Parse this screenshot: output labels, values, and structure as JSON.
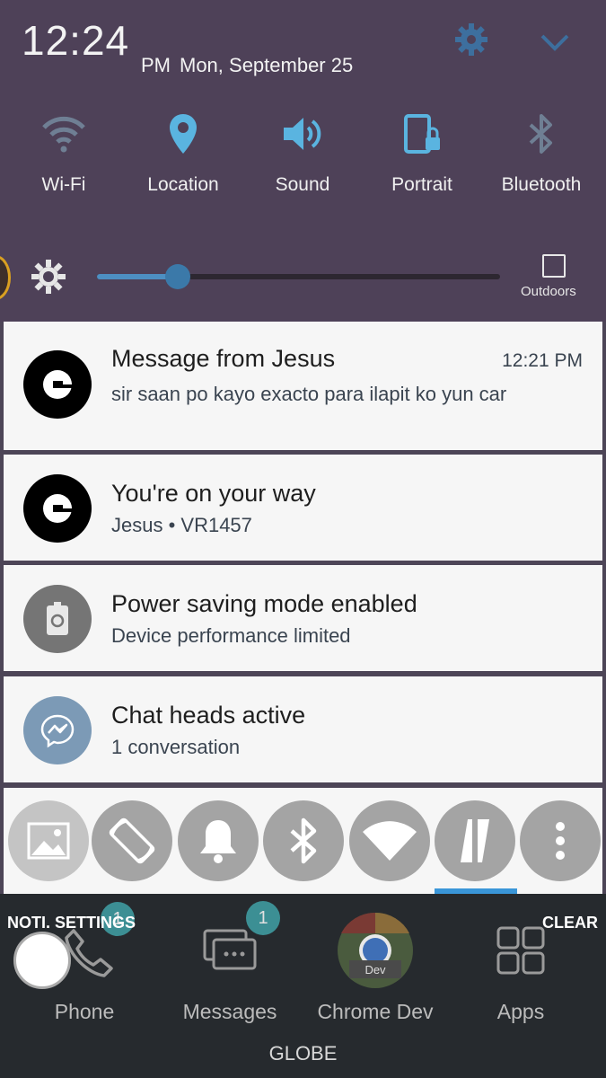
{
  "status": {
    "time": "12:24",
    "ampm": "PM",
    "date": "Mon, September 25"
  },
  "quick_settings": [
    {
      "label": "Wi-Fi",
      "icon": "wifi-icon"
    },
    {
      "label": "Location",
      "icon": "location-pin-icon"
    },
    {
      "label": "Sound",
      "icon": "sound-icon"
    },
    {
      "label": "Portrait",
      "icon": "portrait-lock-icon"
    },
    {
      "label": "Bluetooth",
      "icon": "bluetooth-icon"
    }
  ],
  "brightness": {
    "level": 0.2,
    "outdoors_label": "Outdoors"
  },
  "notifications": [
    {
      "app_icon": "uber-icon",
      "title": "Message from Jesus",
      "time": "12:21 PM",
      "text": "sir saan po kayo exacto para ilapit ko yun car"
    },
    {
      "app_icon": "uber-icon",
      "title": "You're on your way",
      "text": "Jesus • VR1457"
    },
    {
      "app_icon": "battery-recycle-icon",
      "title": "Power saving mode enabled",
      "text": "Device performance limited"
    },
    {
      "app_icon": "messenger-icon",
      "title": "Chat heads active",
      "text": "1 conversation"
    }
  ],
  "toggles": [
    {
      "icon": "image-icon"
    },
    {
      "icon": "auto-rotate-icon"
    },
    {
      "icon": "bell-icon"
    },
    {
      "icon": "bluetooth-icon"
    },
    {
      "icon": "wifi-icon"
    },
    {
      "icon": "data-transfer-icon"
    },
    {
      "icon": "more-vert-icon"
    }
  ],
  "footer": {
    "noti_settings": "NOTI. SETTINGS",
    "clear": "CLEAR"
  },
  "dock": [
    {
      "label": "Phone",
      "badge": "1"
    },
    {
      "label": "Messages",
      "badge": "1"
    },
    {
      "label": "Chrome Dev",
      "sub": "Dev"
    },
    {
      "label": "Apps"
    }
  ],
  "carrier": "GLOBE",
  "colors": {
    "panel": "#4e4158",
    "accent": "#5ab4e0",
    "card": "#f6f6f6",
    "toggle": "#a4a4a4",
    "badge": "#3c8f94"
  }
}
